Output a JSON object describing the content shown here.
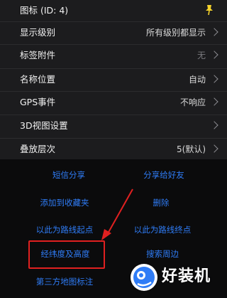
{
  "settings": {
    "rows": [
      {
        "label": "图标 (ID: 4)",
        "value": ""
      },
      {
        "label": "显示级别",
        "value": "所有级别都显示"
      },
      {
        "label": "标签附件",
        "value": "无"
      },
      {
        "label": "名称位置",
        "value": "自动"
      },
      {
        "label": "GPS事件",
        "value": "不响应"
      },
      {
        "label": "3D视图设置",
        "value": ""
      },
      {
        "label": "叠放层次",
        "value": "5(默认)"
      }
    ]
  },
  "actions": {
    "sms_share": "短信分享",
    "share_friend": "分享给好友",
    "add_favorite": "添加到收藏夹",
    "delete": "删除",
    "route_start": "以此为路线起点",
    "route_end": "以此为路线终点",
    "lat_lon_alt": "经纬度及高度",
    "search_nearby": "搜索周边",
    "third_party": "第三方地图标注"
  },
  "watermark": {
    "text": "好装机"
  },
  "colors": {
    "accent": "#2f7cf6",
    "highlight": "#e02020",
    "panel": "#1c1c1e",
    "background": "#0b0b0c"
  }
}
